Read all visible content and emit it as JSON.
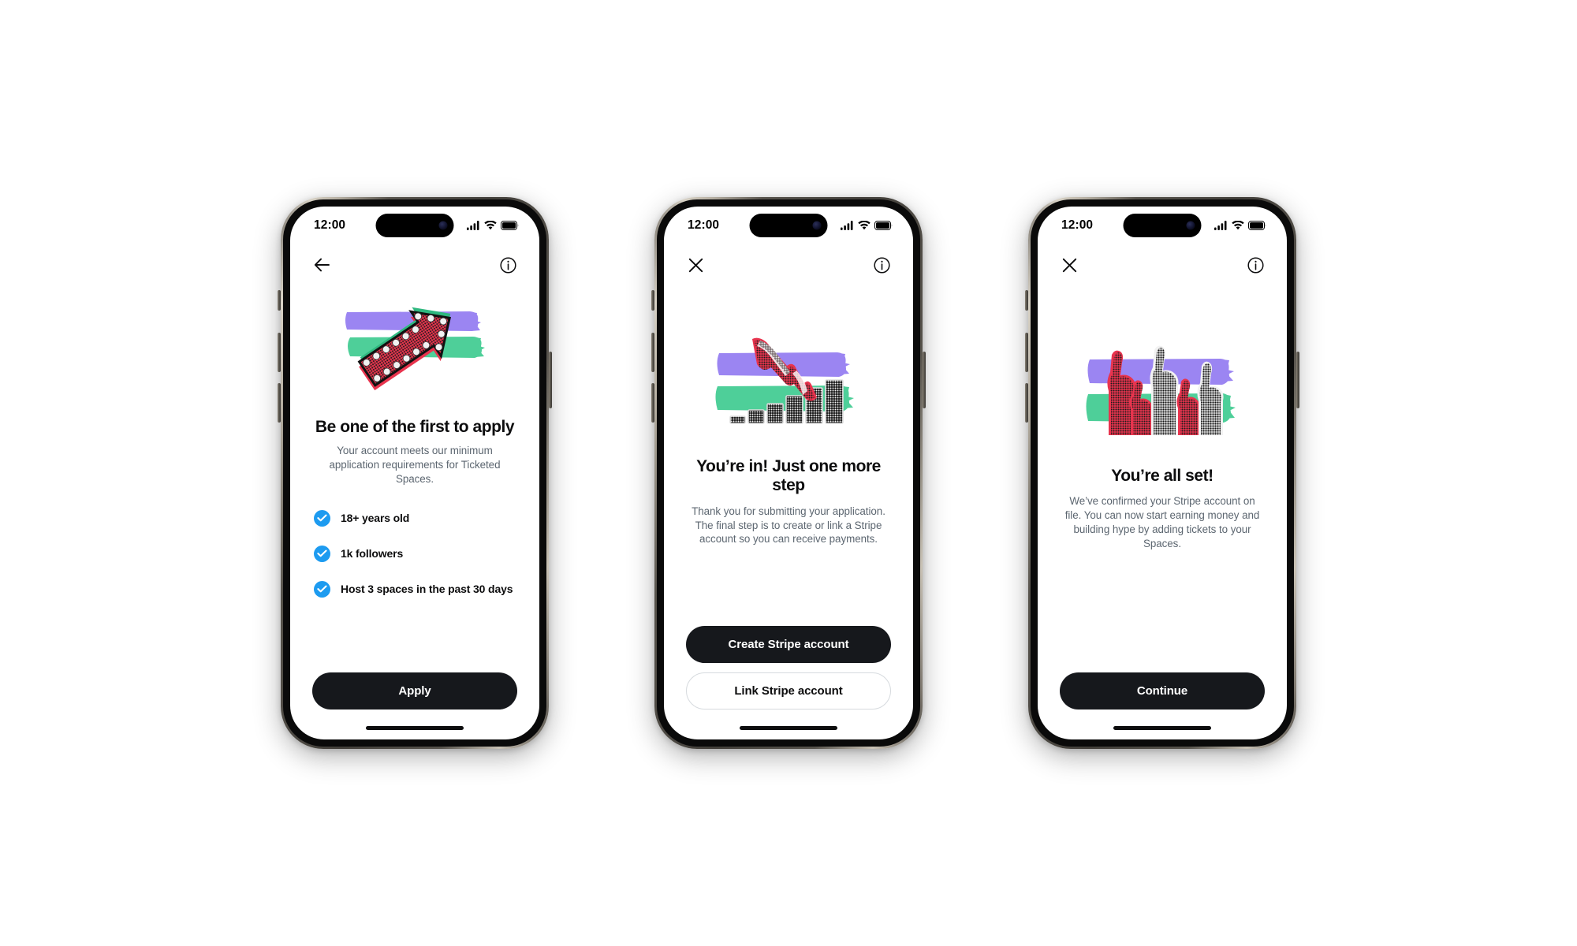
{
  "meta": {
    "colors": {
      "accent_blue": "#1d9bf0",
      "ink": "#0d0d0e",
      "button_dark": "#16181c",
      "muted_text": "#5c6670",
      "brush_purple": "#9b85f2",
      "brush_green": "#4ecf99",
      "illustration_red": "#e8344e",
      "border": "#d6dade"
    }
  },
  "screens": [
    {
      "id": "apply",
      "status_bar": {
        "time": "12:00",
        "signal_icon": "cellular-bars-icon",
        "wifi_icon": "wifi-icon",
        "battery_icon": "battery-full-icon"
      },
      "nav": {
        "left_icon": "back-arrow-icon",
        "left_label": "Back",
        "right_icon": "info-circle-icon",
        "right_label": "Info"
      },
      "illustration": {
        "name": "marquee-arrow-illustration",
        "description": "Red halftone arrow with marquee bulbs over purple and green brush strokes"
      },
      "headline": "Be one of the first to apply",
      "subtext": "Your account meets our minimum application requirements for Ticketed Spaces.",
      "checklist": [
        {
          "label": "18+ years old",
          "checked": true
        },
        {
          "label": "1k followers",
          "checked": true
        },
        {
          "label": "Host 3 spaces in the past 30 days",
          "checked": true
        }
      ],
      "buttons": [
        {
          "label": "Apply",
          "style": "primary",
          "name": "apply-button"
        }
      ]
    },
    {
      "id": "one-more-step",
      "status_bar": {
        "time": "12:00",
        "signal_icon": "cellular-bars-icon",
        "wifi_icon": "wifi-icon",
        "battery_icon": "battery-full-icon"
      },
      "nav": {
        "left_icon": "close-icon",
        "left_label": "Close",
        "right_icon": "info-circle-icon",
        "right_label": "Info"
      },
      "illustration": {
        "name": "hand-coins-illustration",
        "description": "Red halftone hand reaching toward ascending stacks of coins over purple and green brush strokes"
      },
      "headline": "You’re in! Just one more step",
      "subtext": "Thank you for submitting your application. The final step is to create or link a Stripe account so you can receive payments.",
      "checklist": [],
      "buttons": [
        {
          "label": "Create Stripe account",
          "style": "primary",
          "name": "create-stripe-account-button"
        },
        {
          "label": "Link Stripe account",
          "style": "secondary",
          "name": "link-stripe-account-button"
        }
      ]
    },
    {
      "id": "all-set",
      "status_bar": {
        "time": "12:00",
        "signal_icon": "cellular-bars-icon",
        "wifi_icon": "wifi-icon",
        "battery_icon": "battery-full-icon"
      },
      "nav": {
        "left_icon": "close-icon",
        "left_label": "Close",
        "right_icon": "info-circle-icon",
        "right_label": "Info"
      },
      "illustration": {
        "name": "thumbs-up-hands-illustration",
        "description": "Five raised thumbs-up hands in red and greyscale halftone over purple and green brush strokes"
      },
      "headline": "You’re all set!",
      "subtext": "We’ve confirmed your Stripe account on file. You can now start earning money and building hype by adding tickets to your Spaces.",
      "checklist": [],
      "buttons": [
        {
          "label": "Continue",
          "style": "primary",
          "name": "continue-button"
        }
      ]
    }
  ]
}
